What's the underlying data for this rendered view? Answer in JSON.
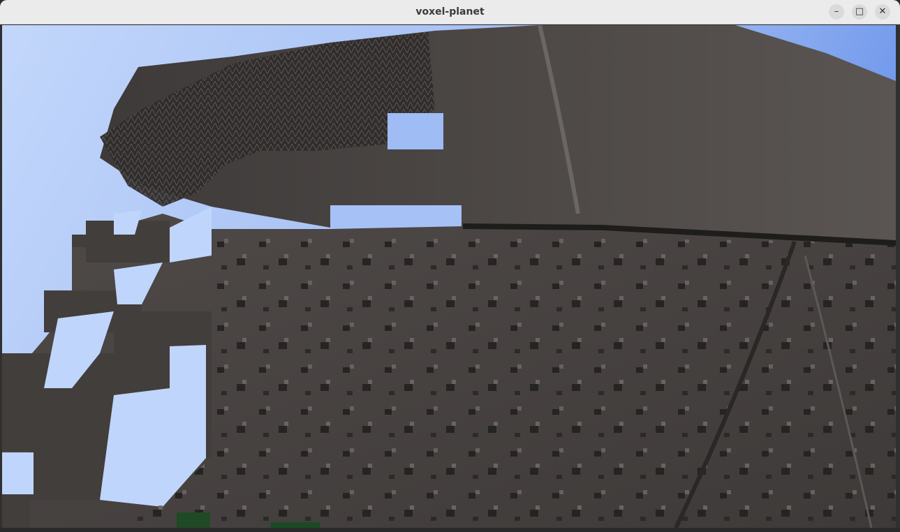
{
  "window": {
    "title": "voxel-planet",
    "buttons": {
      "minimize": "–",
      "maximize": "□",
      "close": "✕"
    }
  },
  "scene": {
    "sky_color_top_left": "#bcd3fb",
    "sky_color_top_right": "#6f97ec",
    "terrain_color": "#4a4644",
    "terrain_dark": "#2a2726",
    "grass_color": "#1f4a25"
  }
}
